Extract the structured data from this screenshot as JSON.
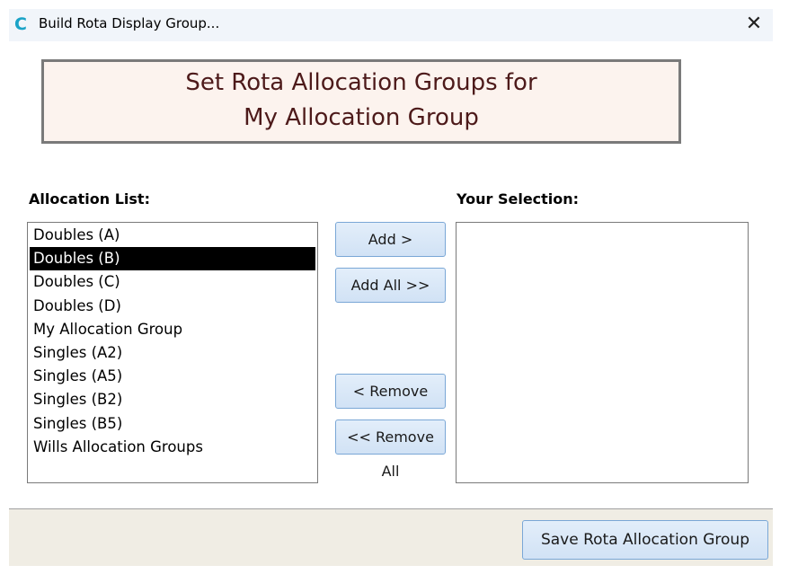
{
  "window": {
    "title": "Build Rota Display Group...",
    "app_icon": "C",
    "close_icon": "✕"
  },
  "header": {
    "line1": "Set Rota Allocation Groups for",
    "line2": "My Allocation Group"
  },
  "allocation_list": {
    "label": "Allocation List:",
    "items": [
      "Doubles (A)",
      "Doubles (B)",
      "Doubles (C)",
      "Doubles (D)",
      "My Allocation Group",
      "Singles (A2)",
      "Singles (A5)",
      "Singles (B2)",
      "Singles (B5)",
      "Wills Allocation Groups"
    ],
    "selected": "Doubles (B)"
  },
  "selection": {
    "label": "Your Selection:",
    "items": []
  },
  "buttons": {
    "add": "Add >",
    "add_all": "Add All >>",
    "remove": "< Remove",
    "remove_all": "<< Remove All",
    "save": "Save Rota Allocation Group"
  },
  "colors": {
    "header_text": "#4d1a1a",
    "header_bg": "#fcf3ee",
    "selected_bg": "#000000",
    "button_border": "#7aa7d6",
    "footer_bg": "#f0ede4"
  }
}
